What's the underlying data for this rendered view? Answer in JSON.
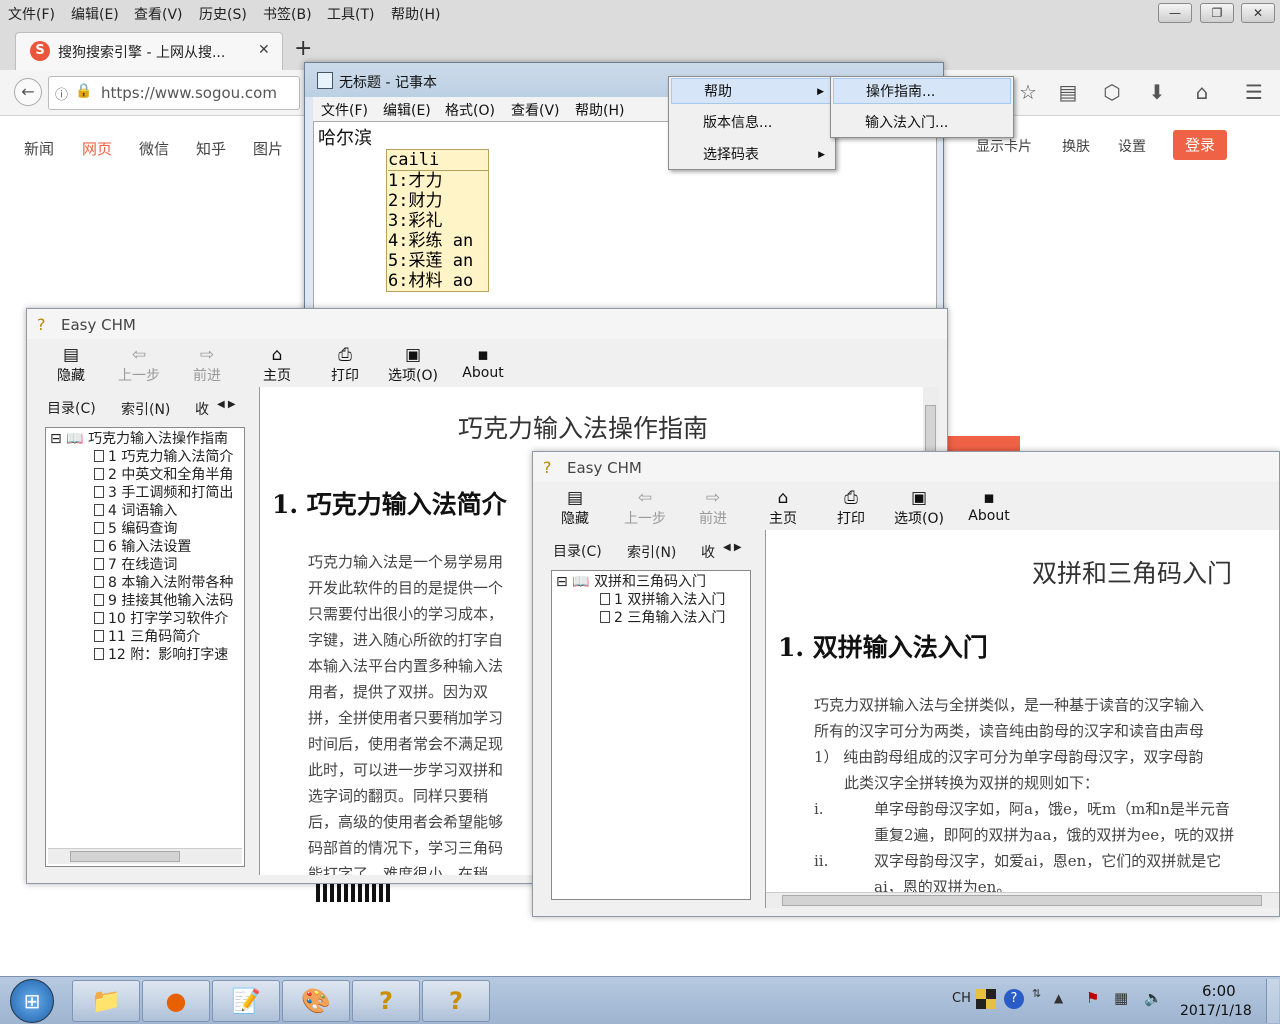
{
  "firefox": {
    "menus": [
      "文件(F)",
      "编辑(E)",
      "查看(V)",
      "历史(S)",
      "书签(B)",
      "工具(T)",
      "帮助(H)"
    ],
    "tab_title": "搜狗搜索引擎 - 上网从搜...",
    "url": "https://www.sogou.com",
    "nav_left": [
      "新闻",
      "网页",
      "微信",
      "知乎",
      "图片"
    ],
    "nav_right": [
      "显示卡片",
      "换肤",
      "设置"
    ],
    "login": "登录",
    "accent": "#f06246"
  },
  "notepad": {
    "title": "无标题 - 记事本",
    "menus": [
      "文件(F)",
      "编辑(E)",
      "格式(O)",
      "查看(V)",
      "帮助(H)"
    ],
    "text": "哈尔滨",
    "ime": {
      "composition": "caili",
      "candidates": [
        "1:才力",
        "2:财力",
        "3:彩礼",
        "4:彩练 an",
        "5:采莲 an",
        "6:材料 ao"
      ]
    }
  },
  "context_menu": {
    "items": [
      "帮助",
      "版本信息...",
      "选择码表"
    ],
    "submenu": [
      "操作指南...",
      "输入法入门..."
    ]
  },
  "chm1": {
    "title": "Easy CHM",
    "toolbar": [
      "隐藏",
      "上一步",
      "前进",
      "主页",
      "打印",
      "选项(O)",
      "About"
    ],
    "tabs": [
      "目录(C)",
      "索引(N)",
      "收"
    ],
    "tree_root": "巧克力输入法操作指南",
    "tree_items": [
      "1 巧克力输入法简介",
      "2 中英文和全角半角",
      "3 手工调频和打简出",
      "4 词语输入",
      "5 编码查询",
      "6 输入法设置",
      "7 在线造词",
      "8 本输入法附带各种",
      "9 挂接其他输入法码",
      "10 打字学习软件介",
      "11 三角码简介",
      "12 附：影响打字速"
    ],
    "doc_title": "巧克力输入法操作指南",
    "heading": "1.  巧克力输入法简介",
    "paragraph": [
      "巧克力输入法是一个易学易用",
      "开发此软件的目的是提供一个",
      "只需要付出很小的学习成本，",
      "字键，进入随心所欲的打字自",
      "本输入法平台内置多种输入法",
      "用者，提供了双拼。因为双",
      "拼，全拼使用者只要稍加学习",
      "时间后，使用者常会不满足现",
      "此时，可以进一步学习双拼和",
      "选字词的翻页。同样只要稍",
      "后，高级的使用者会希望能够",
      "码部首的情况下，学习三角码",
      "能打字了，难度很小，在稍"
    ]
  },
  "chm2": {
    "title": "Easy CHM",
    "toolbar": [
      "隐藏",
      "上一步",
      "前进",
      "主页",
      "打印",
      "选项(O)",
      "About"
    ],
    "tabs": [
      "目录(C)",
      "索引(N)",
      "收"
    ],
    "tree_root": "双拼和三角码入门",
    "tree_items": [
      "1 双拼输入法入门",
      "2 三角输入法入门"
    ],
    "doc_title": "双拼和三角码入门",
    "heading": "1.  双拼输入法入门",
    "paragraph": [
      "巧克力双拼输入法与全拼类似，是一种基于读音的汉字输入",
      "所有的汉字可分为两类，读音纯由韵母的汉字和读音由声母",
      "1） 纯由韵母组成的汉字可分为单字母韵母汉字，双字母韵",
      "此类汉字全拼转换为双拼的规则如下：",
      "单字母韵母汉字如，阿a，饿e，呒m（m和n是半元音",
      "重复2遍，即阿的双拼为aa，饿的双拼为ee，呒的双拼",
      "双字母韵母汉字，如爱ai，恩en，它们的双拼就是它",
      "ai，恩的双拼为en。"
    ],
    "list_marks": [
      "i.",
      "ii."
    ]
  },
  "taskbar": {
    "lang": "CH",
    "time": "6:00",
    "date": "2017/1/18"
  }
}
